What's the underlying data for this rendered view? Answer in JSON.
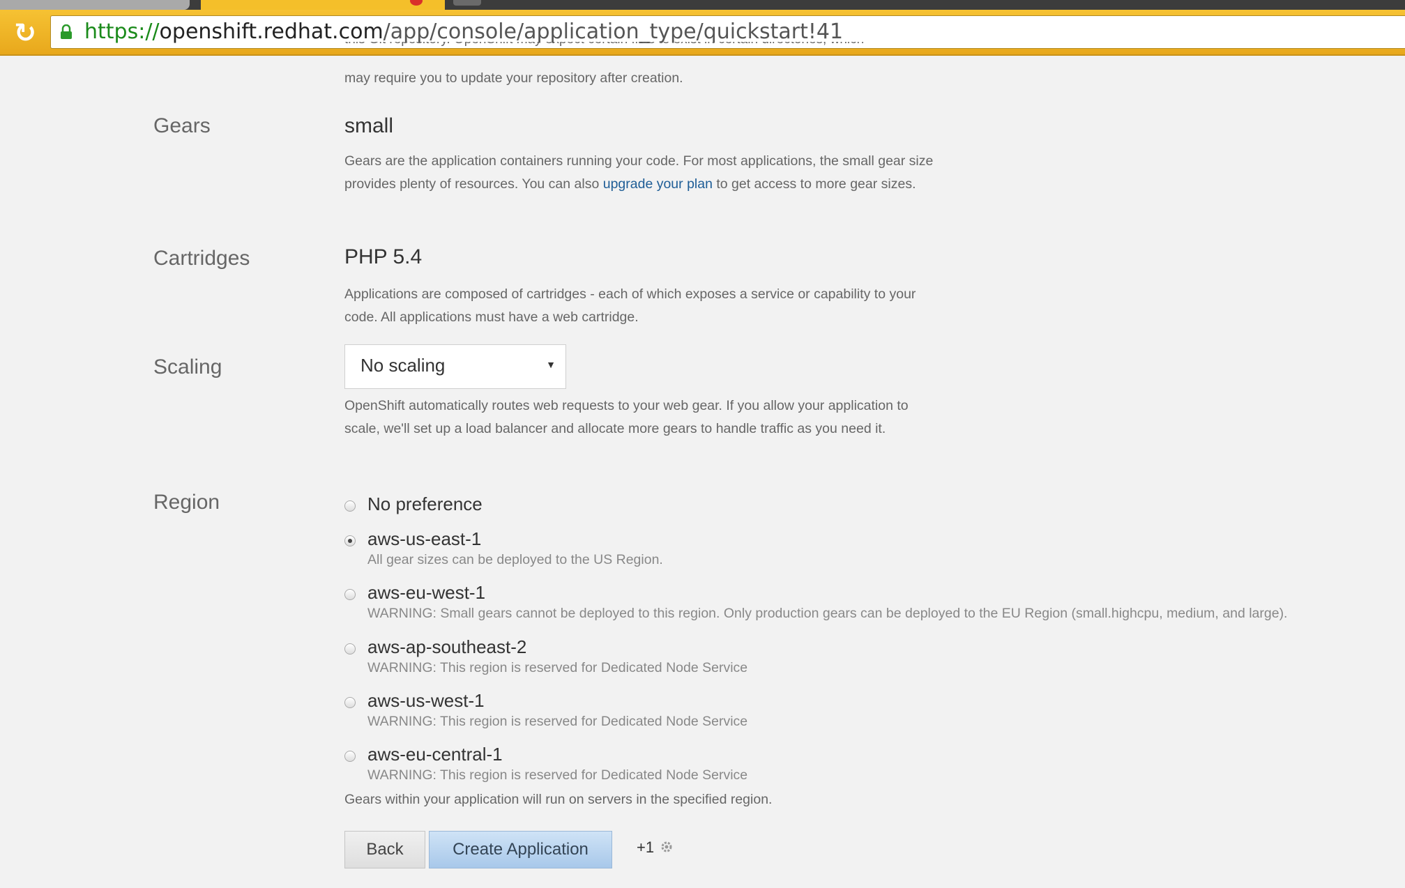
{
  "browser": {
    "url_scheme": "https://",
    "url_host": "openshift.redhat.com",
    "url_path": "/app/console/application_type/quickstart!41"
  },
  "clipped_text_top": "this Git repository. OpenShift may expect certain files to exist in certain directories, which",
  "clipped_text_line2": "may require you to update your repository after creation.",
  "gears": {
    "label": "Gears",
    "value": "small",
    "help_part1": "Gears are the application containers running your code. For most applications, the small gear size provides plenty of resources. You can also ",
    "help_link": "upgrade your plan",
    "help_part2": " to get access to more gear sizes."
  },
  "cartridges": {
    "label": "Cartridges",
    "value": "PHP 5.4",
    "help": "Applications are composed of cartridges - each of which exposes a service or capability to your code. All applications must have a web cartridge."
  },
  "scaling": {
    "label": "Scaling",
    "selected": "No scaling",
    "help": "OpenShift automatically routes web requests to your web gear. If you allow your application to scale, we'll set up a load balancer and allocate more gears to handle traffic as you need it."
  },
  "region": {
    "label": "Region",
    "options": [
      {
        "label": "No preference",
        "note": "",
        "checked": false
      },
      {
        "label": "aws-us-east-1",
        "note": "All gear sizes can be deployed to the US Region.",
        "checked": true
      },
      {
        "label": "aws-eu-west-1",
        "note": "WARNING: Small gears cannot be deployed to this region. Only production gears can be deployed to the EU Region (small.highcpu, medium, and large).",
        "checked": false
      },
      {
        "label": "aws-ap-southeast-2",
        "note": "WARNING: This region is reserved for Dedicated Node Service",
        "checked": false
      },
      {
        "label": "aws-us-west-1",
        "note": "WARNING: This region is reserved for Dedicated Node Service",
        "checked": false
      },
      {
        "label": "aws-eu-central-1",
        "note": "WARNING: This region is reserved for Dedicated Node Service",
        "checked": false
      }
    ],
    "footer": "Gears within your application will run on servers in the specified region."
  },
  "actions": {
    "back_label": "Back",
    "create_label": "Create Application",
    "plus_one": "+1"
  }
}
